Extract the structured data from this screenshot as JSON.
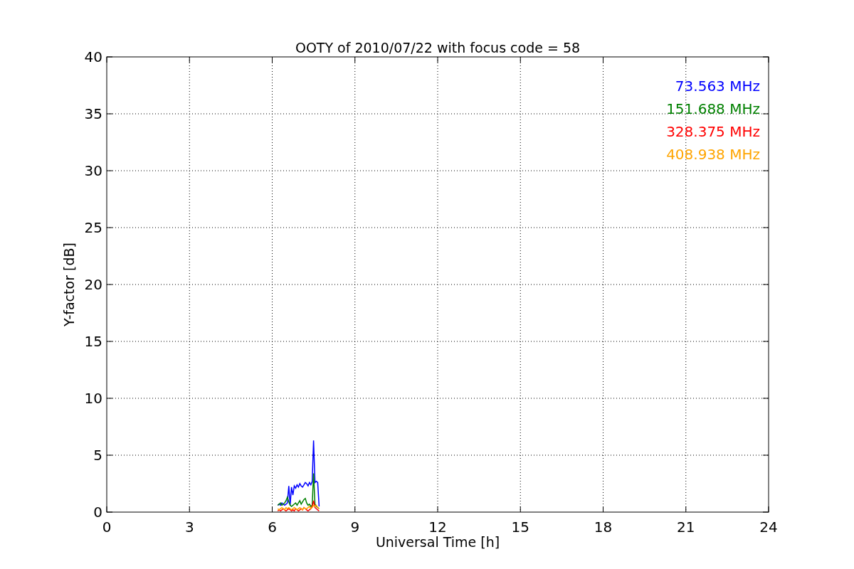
{
  "chart_data": {
    "type": "line",
    "title": "OOTY of 2010/07/22 with focus code = 58",
    "xlabel": "Universal Time [h]",
    "ylabel": "Y-factor [dB]",
    "x": [
      6.2,
      6.25,
      6.3,
      6.35,
      6.4,
      6.45,
      6.5,
      6.55,
      6.6,
      6.65,
      6.7,
      6.75,
      6.8,
      6.85,
      6.9,
      6.95,
      7.0,
      7.05,
      7.1,
      7.15,
      7.2,
      7.25,
      7.3,
      7.35,
      7.4,
      7.45,
      7.5,
      7.55,
      7.6,
      7.65,
      7.7
    ],
    "series": [
      {
        "name": "73.563 MHz",
        "color": "#0000ff",
        "values": [
          0.6,
          0.7,
          0.6,
          0.8,
          0.7,
          0.6,
          0.7,
          0.8,
          2.3,
          0.6,
          2.2,
          1.5,
          2.3,
          2.1,
          2.4,
          2.2,
          2.5,
          2.3,
          2.2,
          2.4,
          2.6,
          2.5,
          2.3,
          2.6,
          2.4,
          2.7,
          6.3,
          2.6,
          2.7,
          2.6,
          0.5
        ]
      },
      {
        "name": "151.688 MHz",
        "color": "#008000",
        "values": [
          0.6,
          0.7,
          0.8,
          0.6,
          0.7,
          0.8,
          1.0,
          1.3,
          0.9,
          0.6,
          0.5,
          0.6,
          0.7,
          0.8,
          0.6,
          0.8,
          1.0,
          0.7,
          0.9,
          1.1,
          1.2,
          0.8,
          0.6,
          0.7,
          0.5,
          0.6,
          3.4,
          0.7,
          0.5,
          0.4,
          0.3
        ]
      },
      {
        "name": "328.375 MHz",
        "color": "#ff0000",
        "values": [
          0.1,
          0.2,
          0.1,
          0.2,
          0.3,
          0.2,
          0.1,
          0.2,
          0.3,
          0.2,
          0.1,
          0.2,
          0.1,
          0.3,
          0.2,
          0.1,
          0.2,
          0.3,
          0.2,
          0.4,
          0.3,
          0.2,
          0.1,
          0.2,
          0.3,
          0.5,
          1.0,
          0.4,
          0.3,
          0.2,
          0.1
        ]
      },
      {
        "name": "408.938 MHz",
        "color": "#ffa500",
        "values": [
          0.3,
          0.2,
          0.3,
          0.4,
          0.3,
          0.2,
          0.4,
          0.3,
          0.4,
          0.3,
          0.2,
          0.3,
          0.4,
          0.3,
          0.2,
          0.3,
          0.4,
          0.3,
          0.2,
          0.4,
          0.3,
          0.3,
          0.4,
          0.5,
          0.3,
          0.4,
          0.6,
          0.5,
          0.6,
          0.4,
          0.3
        ]
      }
    ],
    "xlim": [
      0,
      24
    ],
    "ylim": [
      0,
      40
    ],
    "xticks": [
      0,
      3,
      6,
      9,
      12,
      15,
      18,
      21,
      24
    ],
    "yticks": [
      0,
      5,
      10,
      15,
      20,
      25,
      30,
      35,
      40
    ],
    "grid": true
  }
}
